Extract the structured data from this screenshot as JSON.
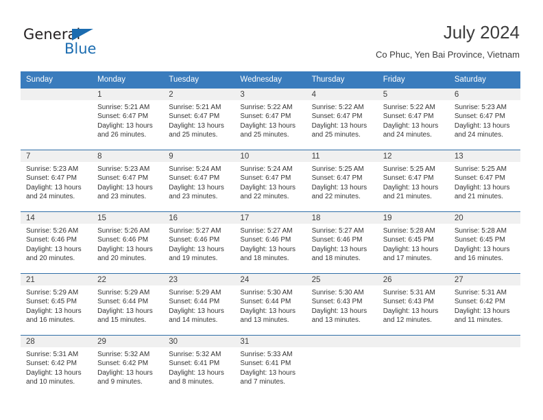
{
  "brand": {
    "name_part1": "General",
    "name_part2": "Blue",
    "flag_icon": "triangle-flag-icon",
    "accent_color": "#1b6cb0"
  },
  "header": {
    "title": "July 2024",
    "subtitle": "Co Phuc, Yen Bai Province, Vietnam"
  },
  "colors": {
    "header_row_bg": "#3a7cbd",
    "week_separator": "#2e6da6",
    "day_number_band": "#f0f0f0",
    "text": "#333333"
  },
  "weekdays": [
    "Sunday",
    "Monday",
    "Tuesday",
    "Wednesday",
    "Thursday",
    "Friday",
    "Saturday"
  ],
  "weeks": [
    [
      {
        "day": "",
        "sunrise": "",
        "sunset": "",
        "daylight_line1": "",
        "daylight_line2": ""
      },
      {
        "day": "1",
        "sunrise": "Sunrise: 5:21 AM",
        "sunset": "Sunset: 6:47 PM",
        "daylight_line1": "Daylight: 13 hours",
        "daylight_line2": "and 26 minutes."
      },
      {
        "day": "2",
        "sunrise": "Sunrise: 5:21 AM",
        "sunset": "Sunset: 6:47 PM",
        "daylight_line1": "Daylight: 13 hours",
        "daylight_line2": "and 25 minutes."
      },
      {
        "day": "3",
        "sunrise": "Sunrise: 5:22 AM",
        "sunset": "Sunset: 6:47 PM",
        "daylight_line1": "Daylight: 13 hours",
        "daylight_line2": "and 25 minutes."
      },
      {
        "day": "4",
        "sunrise": "Sunrise: 5:22 AM",
        "sunset": "Sunset: 6:47 PM",
        "daylight_line1": "Daylight: 13 hours",
        "daylight_line2": "and 25 minutes."
      },
      {
        "day": "5",
        "sunrise": "Sunrise: 5:22 AM",
        "sunset": "Sunset: 6:47 PM",
        "daylight_line1": "Daylight: 13 hours",
        "daylight_line2": "and 24 minutes."
      },
      {
        "day": "6",
        "sunrise": "Sunrise: 5:23 AM",
        "sunset": "Sunset: 6:47 PM",
        "daylight_line1": "Daylight: 13 hours",
        "daylight_line2": "and 24 minutes."
      }
    ],
    [
      {
        "day": "7",
        "sunrise": "Sunrise: 5:23 AM",
        "sunset": "Sunset: 6:47 PM",
        "daylight_line1": "Daylight: 13 hours",
        "daylight_line2": "and 24 minutes."
      },
      {
        "day": "8",
        "sunrise": "Sunrise: 5:23 AM",
        "sunset": "Sunset: 6:47 PM",
        "daylight_line1": "Daylight: 13 hours",
        "daylight_line2": "and 23 minutes."
      },
      {
        "day": "9",
        "sunrise": "Sunrise: 5:24 AM",
        "sunset": "Sunset: 6:47 PM",
        "daylight_line1": "Daylight: 13 hours",
        "daylight_line2": "and 23 minutes."
      },
      {
        "day": "10",
        "sunrise": "Sunrise: 5:24 AM",
        "sunset": "Sunset: 6:47 PM",
        "daylight_line1": "Daylight: 13 hours",
        "daylight_line2": "and 22 minutes."
      },
      {
        "day": "11",
        "sunrise": "Sunrise: 5:25 AM",
        "sunset": "Sunset: 6:47 PM",
        "daylight_line1": "Daylight: 13 hours",
        "daylight_line2": "and 22 minutes."
      },
      {
        "day": "12",
        "sunrise": "Sunrise: 5:25 AM",
        "sunset": "Sunset: 6:47 PM",
        "daylight_line1": "Daylight: 13 hours",
        "daylight_line2": "and 21 minutes."
      },
      {
        "day": "13",
        "sunrise": "Sunrise: 5:25 AM",
        "sunset": "Sunset: 6:47 PM",
        "daylight_line1": "Daylight: 13 hours",
        "daylight_line2": "and 21 minutes."
      }
    ],
    [
      {
        "day": "14",
        "sunrise": "Sunrise: 5:26 AM",
        "sunset": "Sunset: 6:46 PM",
        "daylight_line1": "Daylight: 13 hours",
        "daylight_line2": "and 20 minutes."
      },
      {
        "day": "15",
        "sunrise": "Sunrise: 5:26 AM",
        "sunset": "Sunset: 6:46 PM",
        "daylight_line1": "Daylight: 13 hours",
        "daylight_line2": "and 20 minutes."
      },
      {
        "day": "16",
        "sunrise": "Sunrise: 5:27 AM",
        "sunset": "Sunset: 6:46 PM",
        "daylight_line1": "Daylight: 13 hours",
        "daylight_line2": "and 19 minutes."
      },
      {
        "day": "17",
        "sunrise": "Sunrise: 5:27 AM",
        "sunset": "Sunset: 6:46 PM",
        "daylight_line1": "Daylight: 13 hours",
        "daylight_line2": "and 18 minutes."
      },
      {
        "day": "18",
        "sunrise": "Sunrise: 5:27 AM",
        "sunset": "Sunset: 6:46 PM",
        "daylight_line1": "Daylight: 13 hours",
        "daylight_line2": "and 18 minutes."
      },
      {
        "day": "19",
        "sunrise": "Sunrise: 5:28 AM",
        "sunset": "Sunset: 6:45 PM",
        "daylight_line1": "Daylight: 13 hours",
        "daylight_line2": "and 17 minutes."
      },
      {
        "day": "20",
        "sunrise": "Sunrise: 5:28 AM",
        "sunset": "Sunset: 6:45 PM",
        "daylight_line1": "Daylight: 13 hours",
        "daylight_line2": "and 16 minutes."
      }
    ],
    [
      {
        "day": "21",
        "sunrise": "Sunrise: 5:29 AM",
        "sunset": "Sunset: 6:45 PM",
        "daylight_line1": "Daylight: 13 hours",
        "daylight_line2": "and 16 minutes."
      },
      {
        "day": "22",
        "sunrise": "Sunrise: 5:29 AM",
        "sunset": "Sunset: 6:44 PM",
        "daylight_line1": "Daylight: 13 hours",
        "daylight_line2": "and 15 minutes."
      },
      {
        "day": "23",
        "sunrise": "Sunrise: 5:29 AM",
        "sunset": "Sunset: 6:44 PM",
        "daylight_line1": "Daylight: 13 hours",
        "daylight_line2": "and 14 minutes."
      },
      {
        "day": "24",
        "sunrise": "Sunrise: 5:30 AM",
        "sunset": "Sunset: 6:44 PM",
        "daylight_line1": "Daylight: 13 hours",
        "daylight_line2": "and 13 minutes."
      },
      {
        "day": "25",
        "sunrise": "Sunrise: 5:30 AM",
        "sunset": "Sunset: 6:43 PM",
        "daylight_line1": "Daylight: 13 hours",
        "daylight_line2": "and 13 minutes."
      },
      {
        "day": "26",
        "sunrise": "Sunrise: 5:31 AM",
        "sunset": "Sunset: 6:43 PM",
        "daylight_line1": "Daylight: 13 hours",
        "daylight_line2": "and 12 minutes."
      },
      {
        "day": "27",
        "sunrise": "Sunrise: 5:31 AM",
        "sunset": "Sunset: 6:42 PM",
        "daylight_line1": "Daylight: 13 hours",
        "daylight_line2": "and 11 minutes."
      }
    ],
    [
      {
        "day": "28",
        "sunrise": "Sunrise: 5:31 AM",
        "sunset": "Sunset: 6:42 PM",
        "daylight_line1": "Daylight: 13 hours",
        "daylight_line2": "and 10 minutes."
      },
      {
        "day": "29",
        "sunrise": "Sunrise: 5:32 AM",
        "sunset": "Sunset: 6:42 PM",
        "daylight_line1": "Daylight: 13 hours",
        "daylight_line2": "and 9 minutes."
      },
      {
        "day": "30",
        "sunrise": "Sunrise: 5:32 AM",
        "sunset": "Sunset: 6:41 PM",
        "daylight_line1": "Daylight: 13 hours",
        "daylight_line2": "and 8 minutes."
      },
      {
        "day": "31",
        "sunrise": "Sunrise: 5:33 AM",
        "sunset": "Sunset: 6:41 PM",
        "daylight_line1": "Daylight: 13 hours",
        "daylight_line2": "and 7 minutes."
      },
      {
        "day": "",
        "sunrise": "",
        "sunset": "",
        "daylight_line1": "",
        "daylight_line2": ""
      },
      {
        "day": "",
        "sunrise": "",
        "sunset": "",
        "daylight_line1": "",
        "daylight_line2": ""
      },
      {
        "day": "",
        "sunrise": "",
        "sunset": "",
        "daylight_line1": "",
        "daylight_line2": ""
      }
    ]
  ]
}
